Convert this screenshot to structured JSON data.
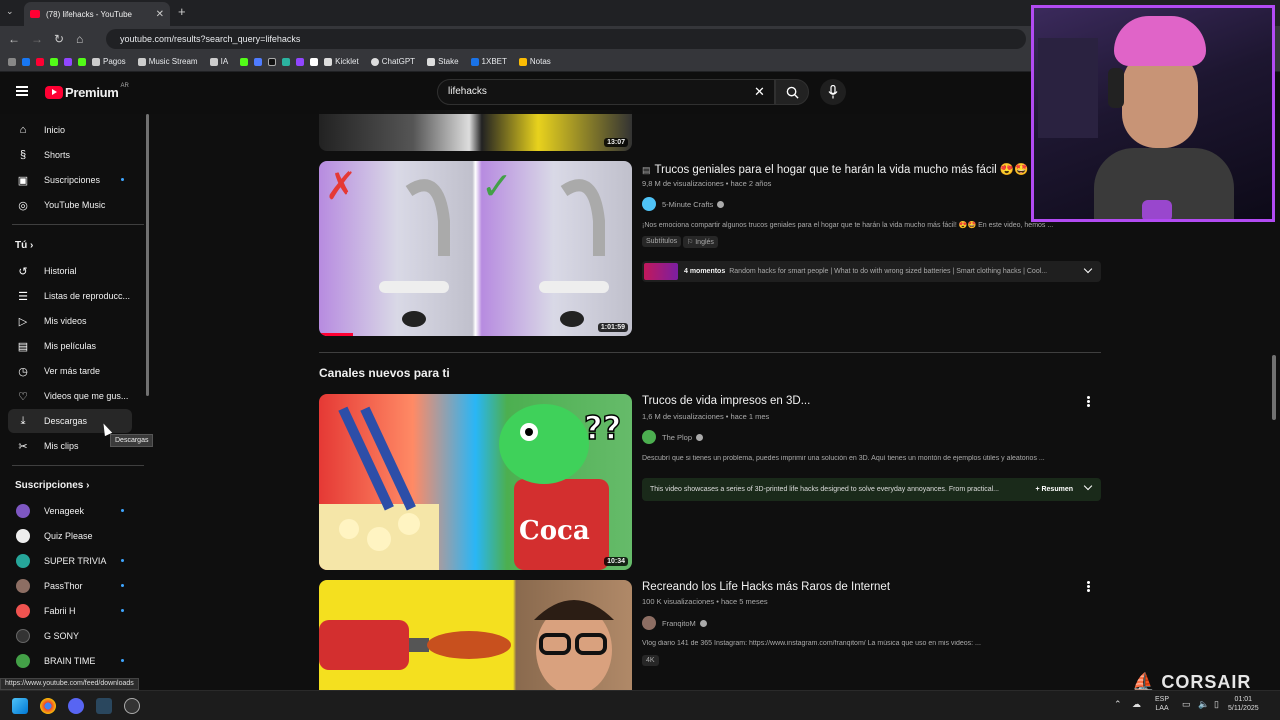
{
  "browser": {
    "tab_title": "(78) lifehacks - YouTube",
    "url": "youtube.com/results?search_query=lifehacks",
    "bookmarks": [
      "Pagos",
      "Music Stream",
      "IA",
      "Kicklet",
      "ChatGPT",
      "Stake",
      "1XBET",
      "Notas"
    ]
  },
  "header": {
    "logo_text": "Premium",
    "country_code": "AR",
    "search_value": "lifehacks"
  },
  "sidebar": {
    "main_items": [
      {
        "label": "Inicio",
        "icon": "home-icon"
      },
      {
        "label": "Shorts",
        "icon": "shorts-icon"
      },
      {
        "label": "Suscripciones",
        "icon": "subscriptions-icon"
      },
      {
        "label": "YouTube Music",
        "icon": "music-icon"
      }
    ],
    "you_title": "Tú",
    "you_items": [
      {
        "label": "Historial",
        "icon": "history-icon"
      },
      {
        "label": "Listas de reproducc...",
        "icon": "playlists-icon"
      },
      {
        "label": "Mis videos",
        "icon": "my-videos-icon"
      },
      {
        "label": "Mis películas",
        "icon": "movies-icon"
      },
      {
        "label": "Ver más tarde",
        "icon": "watch-later-icon"
      },
      {
        "label": "Videos que me gus...",
        "icon": "liked-icon"
      },
      {
        "label": "Descargas",
        "icon": "download-icon"
      },
      {
        "label": "Mis clips",
        "icon": "clips-icon"
      }
    ],
    "subs_title": "Suscripciones",
    "subscriptions": [
      {
        "label": "Venageek",
        "color": "#7e57c2"
      },
      {
        "label": "Quiz Please",
        "color": "#eeeeee"
      },
      {
        "label": "SUPER TRIVIA",
        "color": "#26a69a"
      },
      {
        "label": "PassThor",
        "color": "#8d6e63"
      },
      {
        "label": "Fabrii H",
        "color": "#ef5350"
      },
      {
        "label": "G SONY",
        "color": "#333333"
      },
      {
        "label": "BRAIN TIME",
        "color": "#43a047"
      }
    ],
    "tooltip": "Descargas"
  },
  "videos": [
    {
      "duration": "13:07"
    },
    {
      "title": "Trucos geniales para el hogar que te harán la vida mucho más fácil 😍🤩",
      "views": "9,8 M de visualizaciones",
      "age": "hace 2 años",
      "channel": "5-Minute Crafts",
      "description": "¡Nos emociona compartir algunos trucos geniales para el hogar que te harán la vida mucho más fácil! 😍🤩 En este video, hemos ...",
      "badge1": "Subtítulos",
      "badge2": "Inglés",
      "chapters_count": "4 momentos",
      "chapters_text": "Random hacks for smart people | What to do with wrong sized batteries | Smart clothing hacks | Cool...",
      "duration": "1:01:59"
    },
    {
      "title": "Trucos de vida impresos en 3D...",
      "views": "1,6 M de visualizaciones",
      "age": "hace 1 mes",
      "channel": "The Plop",
      "description": "Descubrí que si tienes un problema, puedes imprimir una solución en 3D. Aquí tienes un montón de ejemplos útiles y aleatorios ...",
      "summary_text": "This video showcases a series of 3D-printed life hacks designed to solve everyday annoyances. From practical...",
      "summary_label": "Resumen",
      "duration": "10:34"
    },
    {
      "title": "Recreando los Life Hacks más Raros de Internet",
      "views": "100 K visualizaciones",
      "age": "hace 5 meses",
      "channel": "FranqitoM",
      "description": "Vlog diario 141 de 365 Instagram: https://www.instagram.com/franqitom/ La música que uso en mis videos: ...",
      "badge1": "4K"
    }
  ],
  "section_title": "Canales nuevos para ti",
  "overlay": {
    "brand": "CORSAIR"
  },
  "statusbar_url": "https://www.youtube.com/feed/downloads",
  "taskbar": {
    "lang1": "ESP",
    "lang2": "LAA",
    "time": "01:01",
    "date": "5/11/2025"
  }
}
